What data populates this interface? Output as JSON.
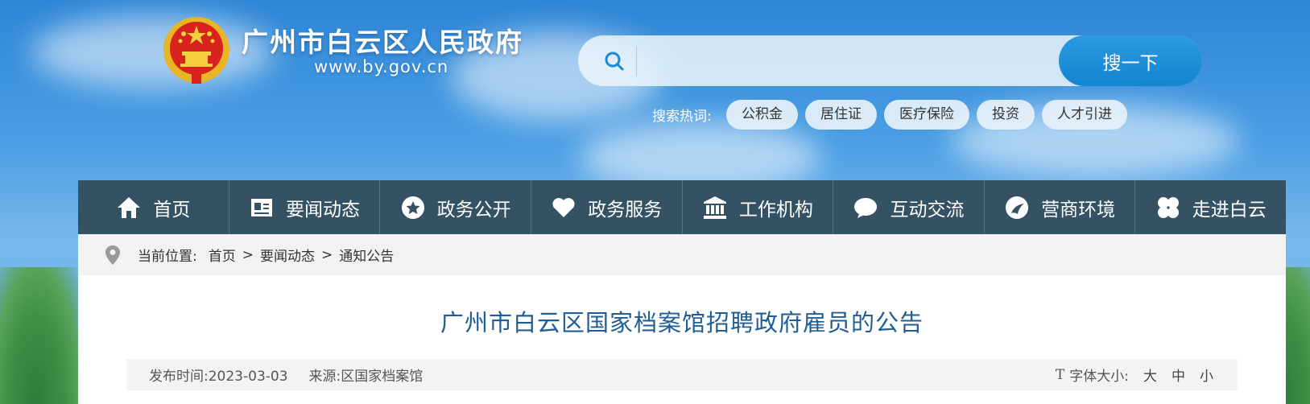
{
  "header": {
    "site_title": "广州市白云区人民政府",
    "site_url": "www.by.gov.cn"
  },
  "search": {
    "placeholder": "",
    "button_label": "搜一下",
    "hot_label": "搜索热词:",
    "hot_tags": [
      "公积金",
      "居住证",
      "医疗保险",
      "投资",
      "人才引进"
    ]
  },
  "nav": {
    "items": [
      {
        "label": "首页",
        "icon": "home-icon"
      },
      {
        "label": "要闻动态",
        "icon": "news-card-icon"
      },
      {
        "label": "政务公开",
        "icon": "star-circle-icon"
      },
      {
        "label": "政务服务",
        "icon": "heart-icon"
      },
      {
        "label": "工作机构",
        "icon": "building-icon"
      },
      {
        "label": "互动交流",
        "icon": "chat-bubble-icon"
      },
      {
        "label": "营商环境",
        "icon": "leaf-swirl-icon"
      },
      {
        "label": "走进白云",
        "icon": "clover-icon"
      }
    ]
  },
  "breadcrumb": {
    "prefix": "当前位置:",
    "items": [
      "首页",
      "要闻动态",
      "通知公告"
    ],
    "separator": ">"
  },
  "article": {
    "title": "广州市白云区国家档案馆招聘政府雇员的公告",
    "publish_label": "发布时间:",
    "publish_date": "2023-03-03",
    "source_label": "来源:",
    "source": "区国家档案馆",
    "font_size_icon": "T",
    "font_size_label": "字体大小:",
    "font_sizes": [
      "大",
      "中",
      "小"
    ]
  },
  "colors": {
    "nav_bg": "#355265",
    "search_button": "#1583cf",
    "title_blue": "#1f5d96"
  }
}
